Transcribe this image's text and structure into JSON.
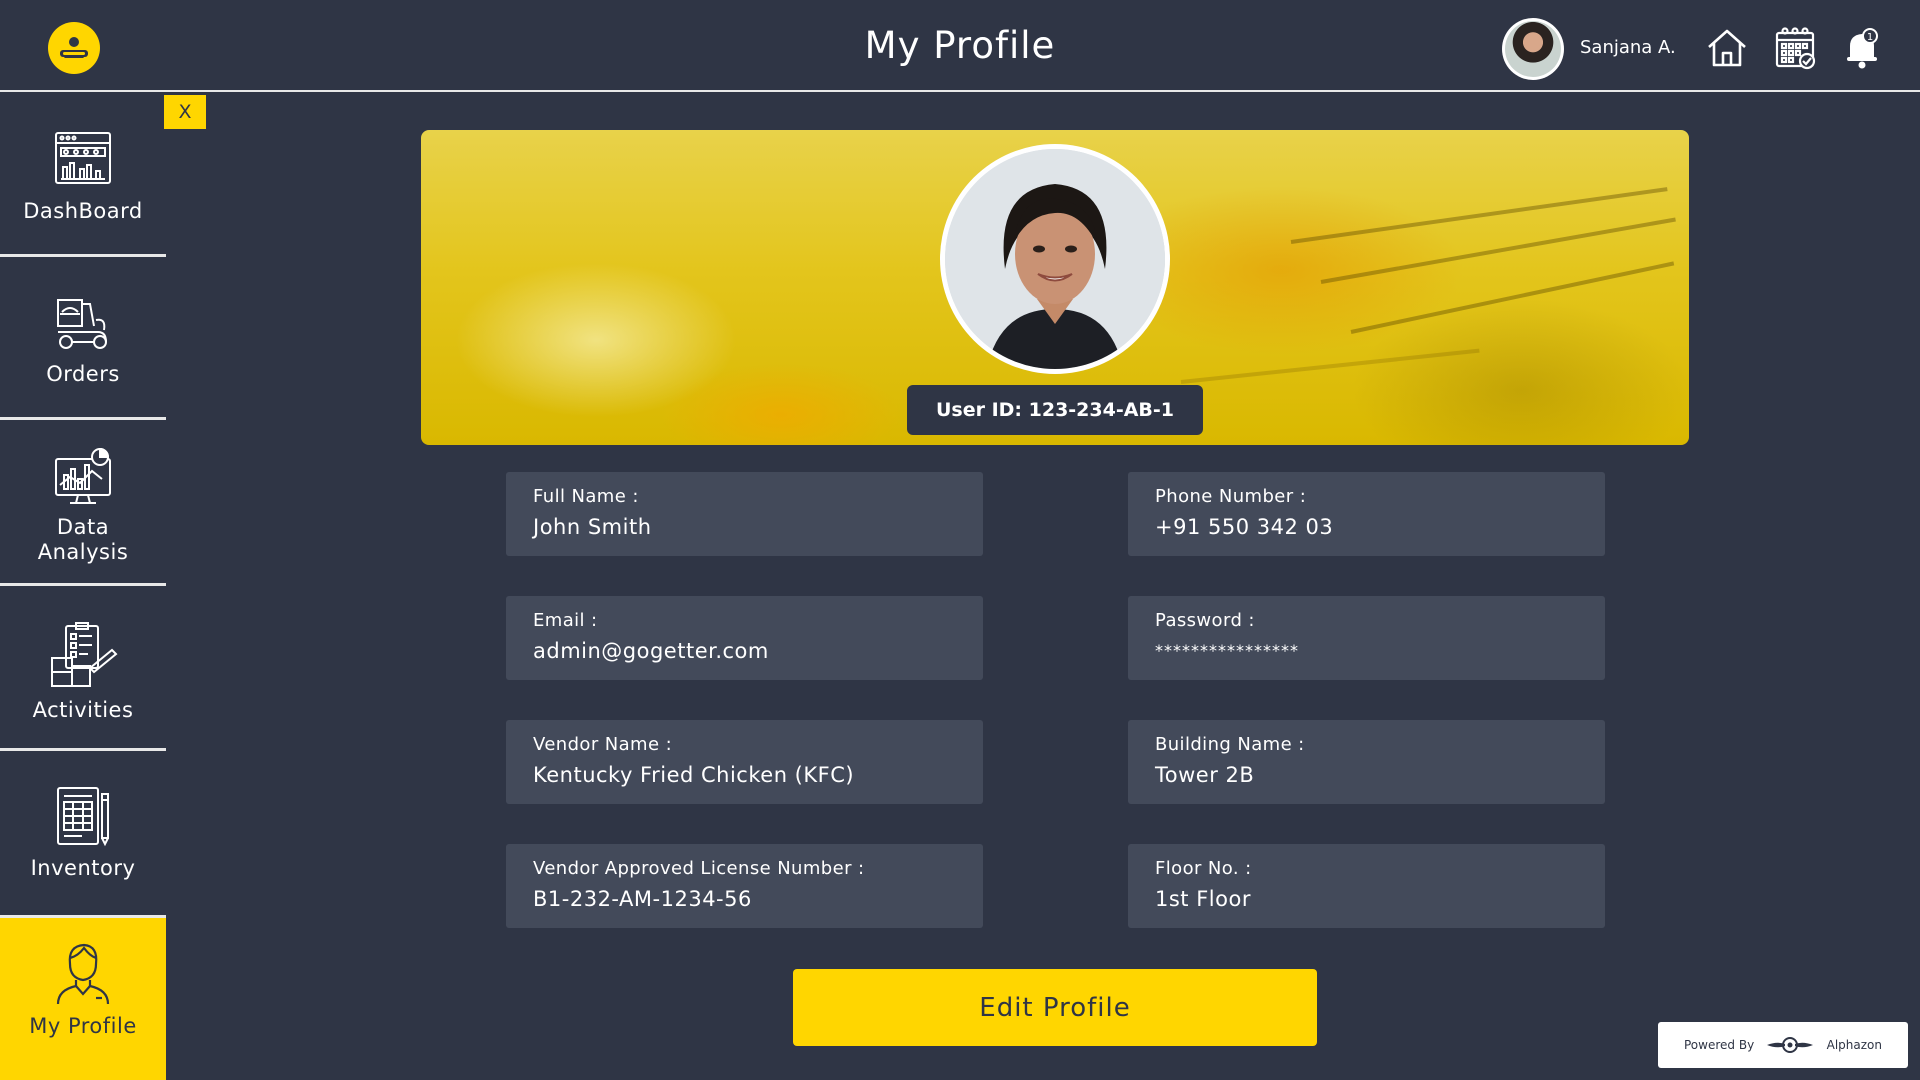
{
  "header": {
    "title": "My Profile",
    "username": "Sanjana A.",
    "icons": [
      "app-logo-icon",
      "home-icon",
      "calendar-icon",
      "notification-bell-icon"
    ]
  },
  "sidebar": {
    "close_label": "X",
    "items": [
      {
        "label": "DashBoard",
        "icon": "dashboard-icon",
        "active": false
      },
      {
        "label": "Orders",
        "icon": "delivery-scooter-icon",
        "active": false
      },
      {
        "label": "Data Analysis",
        "icon": "data-analysis-icon",
        "active": false
      },
      {
        "label": "Activities",
        "icon": "activities-clipboard-icon",
        "active": false
      },
      {
        "label": "Inventory",
        "icon": "inventory-sheet-icon",
        "active": false
      },
      {
        "label": "My Profile",
        "icon": "user-profile-icon",
        "active": true
      }
    ]
  },
  "profile": {
    "user_id": "User ID: 123-234-AB-1",
    "fields": {
      "full_name": {
        "label": "Full Name :",
        "value": "John Smith"
      },
      "phone": {
        "label": "Phone Number :",
        "value": "+91 550 342 03"
      },
      "email": {
        "label": "Email :",
        "value": "admin@gogetter.com"
      },
      "password": {
        "label": "Password :",
        "value": "****************"
      },
      "vendor_name": {
        "label": "Vendor Name :",
        "value": "Kentucky Fried Chicken (KFC)"
      },
      "building_name": {
        "label": "Building Name :",
        "value": "Tower 2B"
      },
      "license": {
        "label": "Vendor Approved License Number :",
        "value": "B1-232-AM-1234-56"
      },
      "floor": {
        "label": "Floor No. :",
        "value": "1st Floor"
      }
    },
    "edit_button": "Edit Profile"
  },
  "footer": {
    "powered_by": "Powered By",
    "brand": "Alphazon"
  },
  "colors": {
    "background": "#2f3545",
    "field": "#434a5a",
    "accent": "#ffd600",
    "text": "#ffffff"
  }
}
